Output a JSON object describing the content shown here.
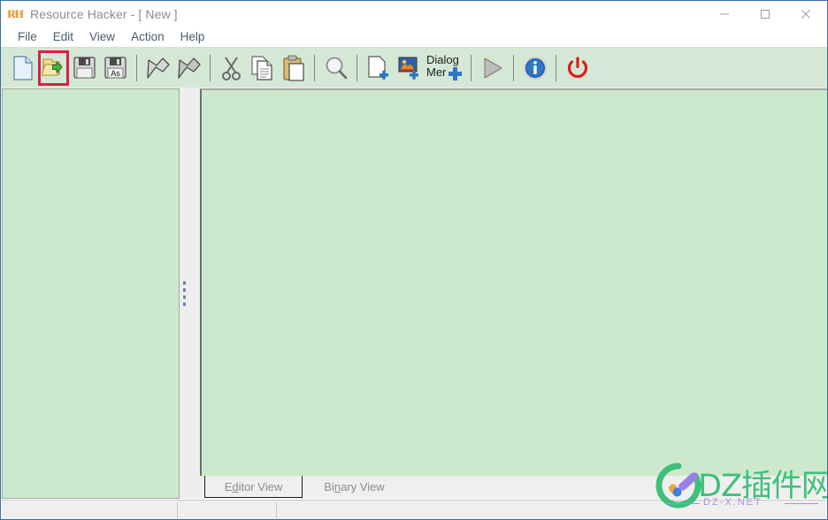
{
  "window": {
    "title": "Resource Hacker - [ New ]",
    "app_icon": "RH",
    "icon_name": "resource-hacker-icon",
    "controls": {
      "minimize": "minimize-icon",
      "maximize": "maximize-icon",
      "close": "close-icon"
    },
    "accent_border": "#3a6ea5"
  },
  "menubar": {
    "items": [
      {
        "label": "File"
      },
      {
        "label": "Edit"
      },
      {
        "label": "View"
      },
      {
        "label": "Action"
      },
      {
        "label": "Help"
      }
    ]
  },
  "toolbar": {
    "background": "#d5e8d5",
    "highlight_color": "#d6214a",
    "buttons": [
      {
        "name": "new-file-button",
        "icon": "new-document-icon",
        "label": "New",
        "highlighted": false
      },
      {
        "name": "open-file-button",
        "icon": "open-folder-icon",
        "label": "Open",
        "highlighted": true
      },
      {
        "name": "save-button",
        "icon": "floppy-disk-icon",
        "label": "Save",
        "highlighted": false
      },
      {
        "name": "save-as-button",
        "icon": "floppy-disk-as-icon",
        "label": "Save As",
        "badge": "As",
        "highlighted": false
      },
      {
        "name": "extract-resource-button",
        "icon": "arrow-shape-icon",
        "label": "Extract",
        "highlighted": false
      },
      {
        "name": "replace-resource-button",
        "icon": "arrow-shape-outline-icon",
        "label": "Replace",
        "highlighted": false
      },
      {
        "name": "cut-button",
        "icon": "scissors-icon",
        "label": "Cut",
        "highlighted": false
      },
      {
        "name": "copy-button",
        "icon": "copy-pages-icon",
        "label": "Copy",
        "highlighted": false
      },
      {
        "name": "paste-button",
        "icon": "clipboard-icon",
        "label": "Paste",
        "highlighted": false
      },
      {
        "name": "find-button",
        "icon": "magnifier-icon",
        "label": "Find",
        "highlighted": false
      },
      {
        "name": "add-resource-button",
        "icon": "page-plus-icon",
        "label": "Add Resource",
        "highlighted": false
      },
      {
        "name": "add-image-button",
        "icon": "image-plus-icon",
        "label": "Add Image",
        "highlighted": false
      },
      {
        "name": "dialog-menu-button",
        "icon": "dialog-menu-plus-icon",
        "label": "Dialog Mer",
        "label_line1": "Dialog",
        "label_line2": "Mer",
        "highlighted": false
      },
      {
        "name": "run-button",
        "icon": "play-triangle-icon",
        "label": "Run",
        "highlighted": false
      },
      {
        "name": "about-button",
        "icon": "info-circle-icon",
        "label": "About",
        "highlighted": false
      },
      {
        "name": "exit-button",
        "icon": "power-icon",
        "label": "Exit",
        "highlighted": false
      }
    ]
  },
  "panels": {
    "tree_panel": {
      "name": "resource-tree-panel",
      "content": "",
      "background": "#cde9cd"
    },
    "editor_panel": {
      "name": "editor-panel",
      "content": "",
      "background": "#cde9cd"
    },
    "splitter": {
      "name": "panel-splitter"
    }
  },
  "tabs": [
    {
      "name": "tab-editor-view",
      "label_pre": "E",
      "label_accel": "d",
      "label_post": "itor View",
      "label": "Editor View",
      "active": true
    },
    {
      "name": "tab-binary-view",
      "label_pre": "Bi",
      "label_accel": "n",
      "label_post": "ary View",
      "label": "Binary View",
      "active": false
    }
  ],
  "statusbar": {
    "pane_1": "",
    "pane_2": "",
    "pane_3": ""
  },
  "watermark": {
    "text": "DZ插件网",
    "subtext": "DZ-X.NET",
    "logo": "dz-check-circle-logo",
    "color": "#3fc07a",
    "sub_color": "#b08fd8"
  }
}
